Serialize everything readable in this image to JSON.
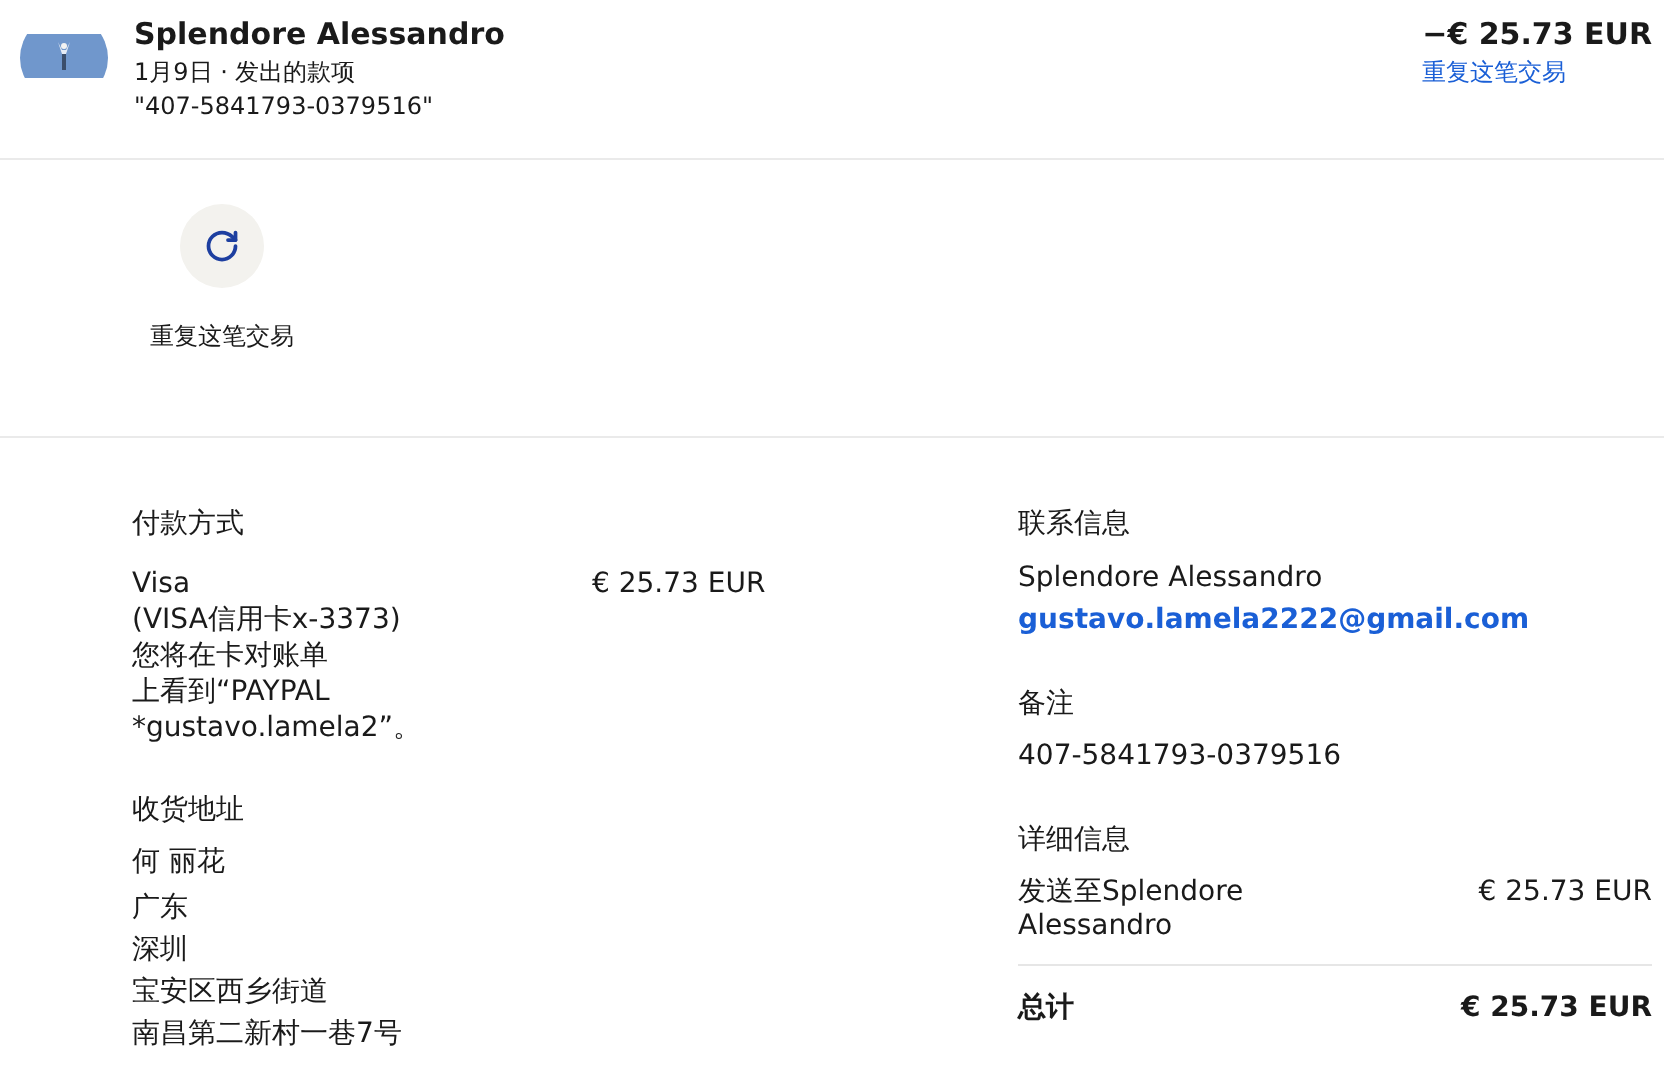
{
  "header": {
    "name": "Splendore Alessandro",
    "subtitle": "1月9日 · 发出的款项",
    "reference": "\"407-5841793-0379516\"",
    "amount": "−€ 25.73 EUR",
    "repeat_link": "重复这笔交易"
  },
  "actions": [
    {
      "label": "重复这笔交易"
    }
  ],
  "payment": {
    "title": "付款方式",
    "lines": [
      "Visa",
      "(VISA信用卡x-3373)",
      "您将在卡对账单",
      "上看到“PAYPAL",
      "*gustavo.lamela2”。"
    ],
    "amount": "€ 25.73 EUR"
  },
  "shipping": {
    "title": "收货地址",
    "name": "何 丽花",
    "lines": [
      "广东",
      "深圳",
      "宝安区西乡街道",
      "南昌第二新村一巷7号"
    ]
  },
  "contact": {
    "title": "联系信息",
    "name": "Splendore Alessandro",
    "email": "gustavo.lamela2222@gmail.com"
  },
  "note": {
    "title": "备注",
    "text": "407-5841793-0379516"
  },
  "details": {
    "title": "详细信息",
    "items": [
      {
        "label": "发送至Splendore Alessandro",
        "amount": "€ 25.73 EUR"
      }
    ],
    "total_label": "总计",
    "total_amount": "€ 25.73 EUR"
  }
}
